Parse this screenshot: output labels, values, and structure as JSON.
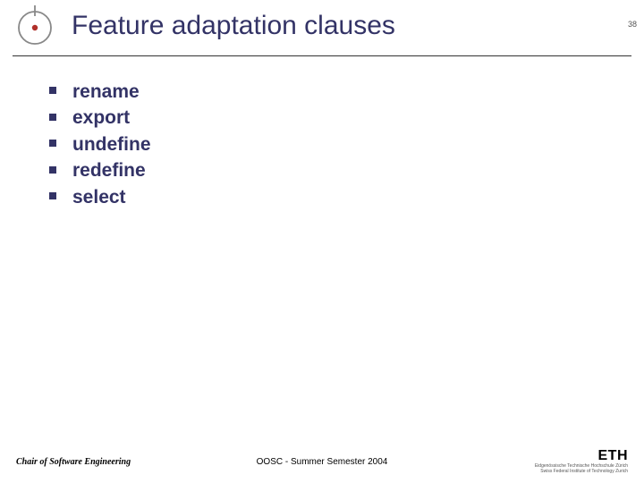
{
  "title": "Feature adaptation clauses",
  "page_number": "38",
  "bullets": [
    "rename",
    "export",
    "undefine",
    "redefine",
    "select"
  ],
  "footer": {
    "left": "Chair of Software Engineering",
    "center": "OOSC - Summer Semester 2004",
    "institution": "ETH",
    "institution_sub1": "Eidgenössische Technische Hochschule Zürich",
    "institution_sub2": "Swiss Federal Institute of Technology Zurich"
  }
}
